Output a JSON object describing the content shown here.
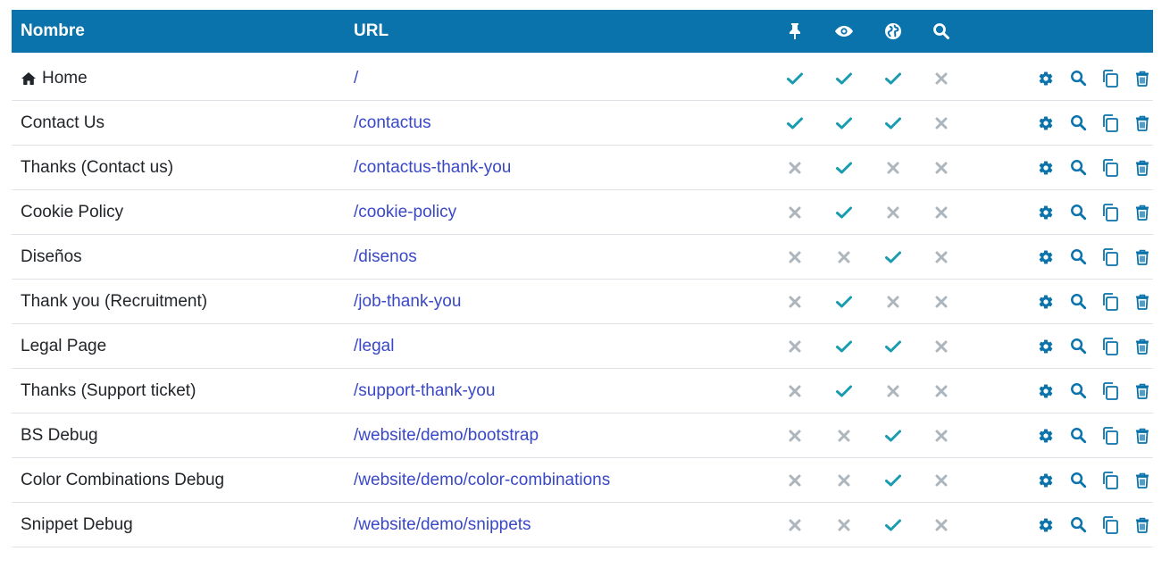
{
  "colors": {
    "header_bg": "#0b73ab",
    "check": "#1a9cb0",
    "cross": "#adb5bd",
    "action": "#0b73ab",
    "link": "#3948c6"
  },
  "header": {
    "name_label": "Nombre",
    "url_label": "URL",
    "flag_icons": [
      "pin-icon",
      "eye-icon",
      "globe-icon",
      "search-icon"
    ]
  },
  "rows": [
    {
      "name": "Home",
      "url": "/",
      "home": true,
      "flags": [
        true,
        true,
        true,
        false
      ]
    },
    {
      "name": "Contact Us",
      "url": "/contactus",
      "flags": [
        true,
        true,
        true,
        false
      ]
    },
    {
      "name": "Thanks (Contact us)",
      "url": "/contactus-thank-you",
      "flags": [
        false,
        true,
        false,
        false
      ]
    },
    {
      "name": "Cookie Policy",
      "url": "/cookie-policy",
      "flags": [
        false,
        true,
        false,
        false
      ]
    },
    {
      "name": "Diseños",
      "url": "/disenos",
      "flags": [
        false,
        false,
        true,
        false
      ]
    },
    {
      "name": "Thank you (Recruitment)",
      "url": "/job-thank-you",
      "flags": [
        false,
        true,
        false,
        false
      ]
    },
    {
      "name": "Legal Page",
      "url": "/legal",
      "flags": [
        false,
        true,
        true,
        false
      ]
    },
    {
      "name": "Thanks (Support ticket)",
      "url": "/support-thank-you",
      "flags": [
        false,
        true,
        false,
        false
      ]
    },
    {
      "name": "BS Debug",
      "url": "/website/demo/bootstrap",
      "flags": [
        false,
        false,
        true,
        false
      ]
    },
    {
      "name": "Color Combinations Debug",
      "url": "/website/demo/color-combinations",
      "flags": [
        false,
        false,
        true,
        false
      ]
    },
    {
      "name": "Snippet Debug",
      "url": "/website/demo/snippets",
      "flags": [
        false,
        false,
        true,
        false
      ]
    }
  ],
  "row_actions": [
    "gear-icon",
    "search-icon",
    "copy-icon",
    "trash-icon"
  ]
}
